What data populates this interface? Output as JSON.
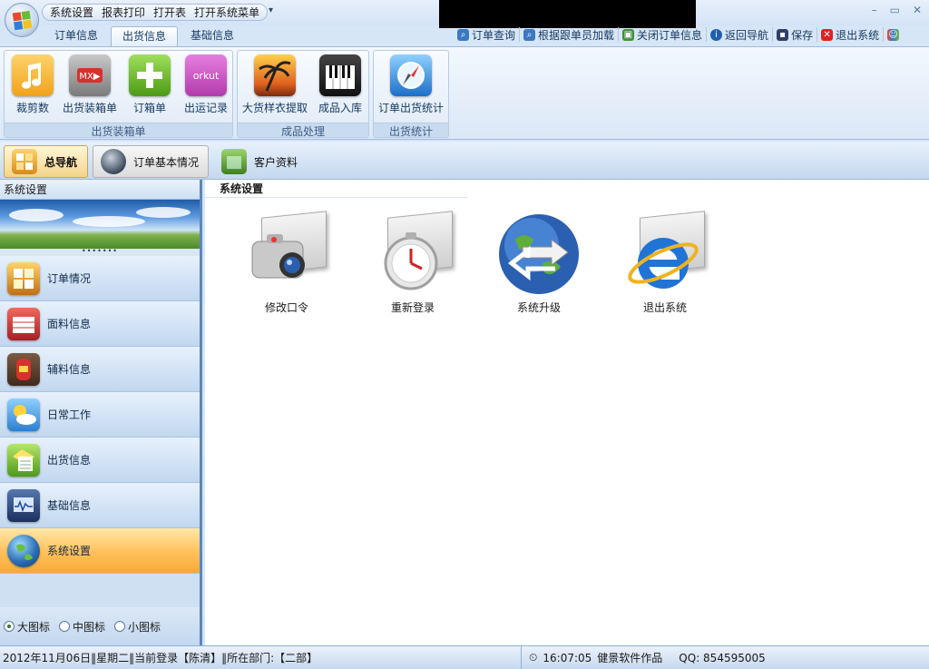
{
  "quick_access": {
    "items": [
      "系统设置",
      "报表打印",
      "打开表",
      "打开系统菜单"
    ],
    "dropdown": "▾"
  },
  "window_controls": [
    "–",
    "▭",
    "✕"
  ],
  "ribbon_tabs": [
    "订单信息",
    "出货信息",
    "基础信息"
  ],
  "ribbon_active_tab": "出货信息",
  "top_tools": [
    {
      "label": "订单查询",
      "icon": "search-icon",
      "color": "#3a78c2"
    },
    {
      "label": "根据跟单员加载",
      "icon": "search-icon",
      "color": "#3a78c2"
    },
    {
      "label": "关闭订单信息",
      "icon": "close-doc-icon",
      "color": "#3f8f3f"
    },
    {
      "label": "返回导航",
      "icon": "info-icon",
      "color": "#1f5fb0"
    },
    {
      "label": "保存",
      "icon": "save-icon",
      "color": "#2e3f66"
    },
    {
      "label": "退出系统",
      "icon": "exit-icon",
      "color": "#d22"
    }
  ],
  "ribbon_groups": [
    {
      "label": "出货装箱单",
      "buttons": [
        {
          "label": "裁剪数",
          "icon": "music-note-icon",
          "color": "#f0a21b"
        },
        {
          "label": "出货装箱单",
          "icon": "mx-player-icon",
          "color": "#8b8b8b"
        },
        {
          "label": "订箱单",
          "icon": "plus-icon",
          "color": "#6ab823"
        },
        {
          "label": "出运记录",
          "icon": "orkut-icon",
          "color": "#c54dbf"
        }
      ]
    },
    {
      "label": "成品处理",
      "buttons": [
        {
          "label": "大货样衣提取",
          "icon": "palm-sunset-icon",
          "color": "#e07a1e"
        },
        {
          "label": "成品入库",
          "icon": "piano-icon",
          "color": "#222222"
        }
      ]
    },
    {
      "label": "出货统计",
      "buttons": [
        {
          "label": "订单出货统计",
          "icon": "compass-icon",
          "color": "#2f7fd6"
        }
      ]
    }
  ],
  "nav_tabs": [
    {
      "label": "总导航",
      "icon": "navigator-icon"
    },
    {
      "label": "订单基本情况",
      "icon": "globe-icon"
    },
    {
      "label": "客户资料",
      "icon": "calculator-icon"
    }
  ],
  "left_panel": {
    "title": "系统设置",
    "grip": "•••••••",
    "items": [
      {
        "label": "订单情况",
        "icon": "notes-icon",
        "color": "#d98a1c"
      },
      {
        "label": "面料信息",
        "icon": "calendar-icon",
        "color": "#c8282c"
      },
      {
        "label": "辅料信息",
        "icon": "mailbox-icon",
        "color": "#b53025"
      },
      {
        "label": "日常工作",
        "icon": "weather-icon",
        "color": "#3a8fd9"
      },
      {
        "label": "出货信息",
        "icon": "note-pad-icon",
        "color": "#5fa832"
      },
      {
        "label": "基础信息",
        "icon": "monitor-icon",
        "color": "#2b4f8a"
      },
      {
        "label": "系统设置",
        "icon": "globe-icon",
        "color": "#2d6fb8"
      }
    ],
    "selected": "系统设置",
    "view_options": [
      {
        "label": "大图标",
        "checked": true
      },
      {
        "label": "中图标",
        "checked": false
      },
      {
        "label": "小图标",
        "checked": false
      }
    ]
  },
  "main": {
    "title": "系统设置",
    "items": [
      {
        "label": "修改口令",
        "icon": "camera-icon"
      },
      {
        "label": "重新登录",
        "icon": "clock-icon"
      },
      {
        "label": "系统升级",
        "icon": "globe-sync-icon"
      },
      {
        "label": "退出系统",
        "icon": "ie-icon"
      }
    ]
  },
  "status_bar": {
    "left": "2012年11月06日‖星期二‖当前登录【陈清】‖所在部门:【二部】",
    "time": "16:07:05",
    "author": "健景软件作品",
    "qq": "QQ: 854595005"
  }
}
